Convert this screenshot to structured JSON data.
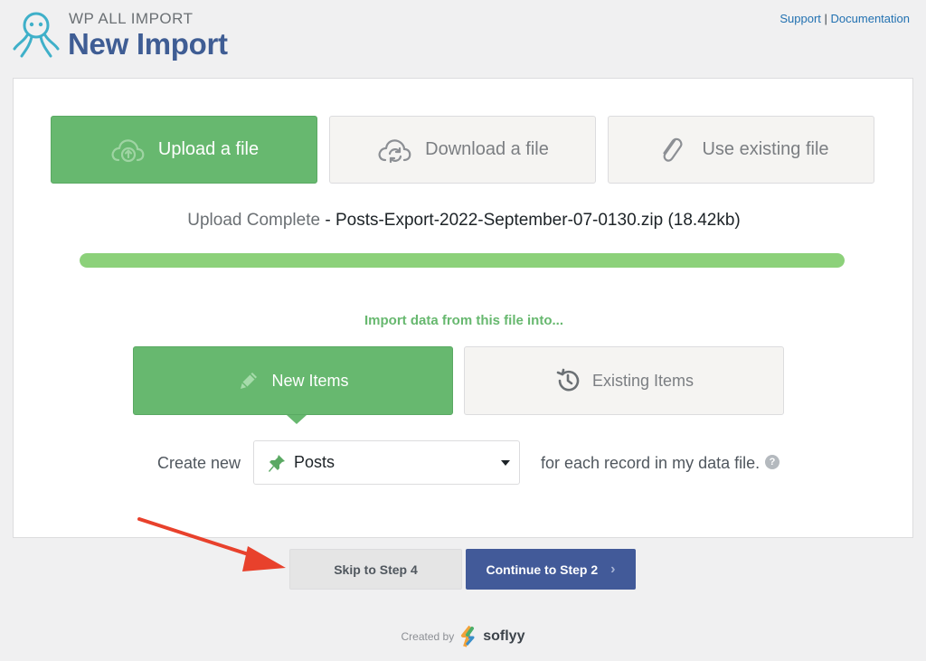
{
  "header": {
    "brand": "WP ALL IMPORT",
    "title": "New Import",
    "links": {
      "support": "Support",
      "separator": "|",
      "documentation": "Documentation"
    }
  },
  "sources": [
    {
      "label": "Upload a file",
      "icon": "cloud-upload-icon",
      "active": true
    },
    {
      "label": "Download a file",
      "icon": "cloud-sync-icon",
      "active": false
    },
    {
      "label": "Use existing file",
      "icon": "paperclip-icon",
      "active": false
    }
  ],
  "upload": {
    "status_label": "Upload Complete",
    "separator": " - ",
    "file": "Posts-Export-2022-September-07-0130.zip (18.42kb)",
    "progress": 1.0
  },
  "import_into": {
    "heading": "Import data from this file into...",
    "new_items": "New Items",
    "existing_items": "Existing Items"
  },
  "create": {
    "label": "Create new",
    "selected": "Posts",
    "suffix": "for each record in my data file.",
    "help": "?"
  },
  "actions": {
    "skip": "Skip to Step 4",
    "continue": "Continue to Step 2",
    "continue_chevron": "›"
  },
  "footer": {
    "created_by": "Created by",
    "brand": "soflyy"
  },
  "colors": {
    "green": "#67b86f",
    "blue": "#425a99",
    "title_blue": "#3f5d94",
    "progress": "#8cd17a",
    "annotation_red": "#e8412c"
  }
}
